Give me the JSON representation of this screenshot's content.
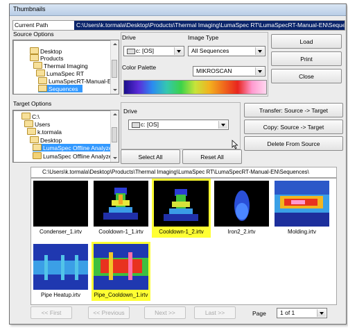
{
  "window": {
    "title": "Thumbnails"
  },
  "current_path": {
    "label": "Current Path",
    "value": "C:\\Users\\k.tormala\\Desktop\\Products\\Thermal Imaging\\LumaSpec RT\\LumaSpecRT-Manual-EN\\Sequences\\"
  },
  "source": {
    "label": "Source Options",
    "tree": [
      "Desktop",
      "Products",
      "Thermal Imaging",
      "LumaSpec RT",
      "LumaSpecRT-Manual-EN",
      "Sequences"
    ],
    "drive_label": "Drive",
    "drive_value": "c: [OS]",
    "image_type_label": "Image Type",
    "image_type_value": "All Sequences",
    "palette_label": "Color Palette",
    "palette_value": "MIKROSCAN"
  },
  "actions": {
    "load": "Load",
    "print": "Print",
    "close": "Close"
  },
  "target": {
    "label": "Target Options",
    "tree": [
      "C:\\",
      "Users",
      "k.tormala",
      "Desktop",
      "LumaSpec Offline Analyzer",
      "LumaSpec Offline Analyzer"
    ],
    "drive_label": "Drive",
    "drive_value": "c: [OS]",
    "select_all": "Select All",
    "reset_all": "Reset All"
  },
  "transfer": {
    "transfer": "Transfer:  Source -> Target",
    "copy": "Copy:  Source -> Target",
    "delete": "Delete From Source"
  },
  "gallery": {
    "path": "C:\\Users\\k.tormala\\Desktop\\Products\\Thermal Imaging\\LumaSpec RT\\LumaSpecRT-Manual-EN\\Sequences\\",
    "items": [
      {
        "name": "Condenser_1.irtv",
        "selected": false
      },
      {
        "name": "Cooldown-1_1.irtv",
        "selected": false
      },
      {
        "name": "Cooldown-1_2.irtv",
        "selected": true
      },
      {
        "name": "Iron2_2.irtv",
        "selected": false
      },
      {
        "name": "Molding.irtv",
        "selected": false
      },
      {
        "name": "Pipe Heatup.irtv",
        "selected": false
      },
      {
        "name": "Pipe_Cooldown_1.irtv",
        "selected": true
      }
    ]
  },
  "pager": {
    "first": "<< First",
    "previous": "<< Previous",
    "next": "Next >>",
    "last": "Last >>",
    "page_label": "Page",
    "page_value": "1 of 1"
  },
  "colors": {
    "selection": "#3399ff",
    "thumb_highlight": "#ffff33",
    "path_bg": "#0a246a"
  }
}
